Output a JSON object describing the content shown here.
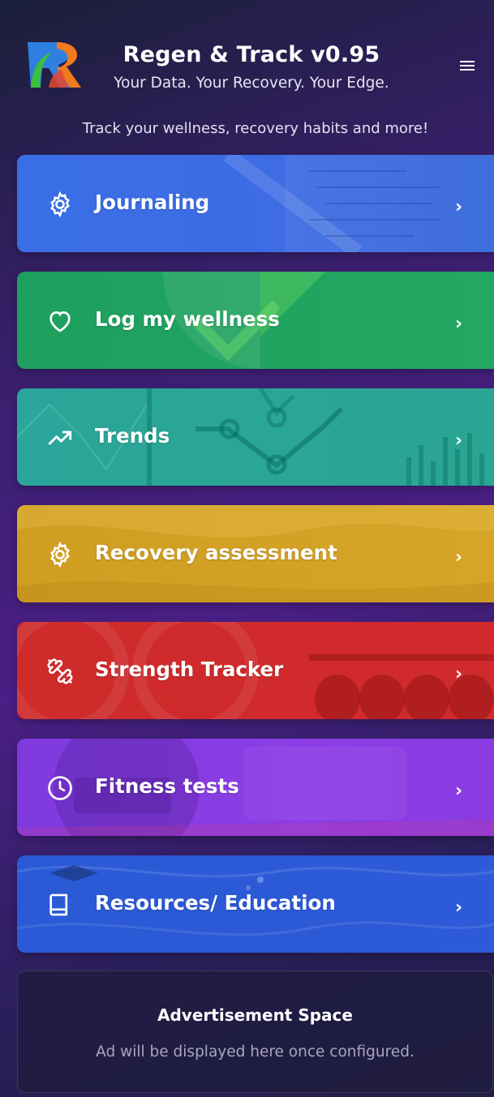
{
  "header": {
    "title": "Regen & Track v0.95",
    "tagline": "Your Data. Your Recovery. Your Edge.",
    "menu_icon": "hamburger-menu-icon"
  },
  "subtitle": "Track your wellness, recovery habits and more!",
  "cards": [
    {
      "label": "Journaling",
      "icon": "gear-icon",
      "color": "#3b6fe0"
    },
    {
      "label": "Log my wellness",
      "icon": "heart-icon",
      "color": "#1fa35f"
    },
    {
      "label": "Trends",
      "icon": "trending-up-icon",
      "color": "#2aa596"
    },
    {
      "label": "Recovery assessment",
      "icon": "gear-icon",
      "color": "#d4a121"
    },
    {
      "label": "Strength Tracker",
      "icon": "dumbbell-icon",
      "color": "#cf2a2a"
    },
    {
      "label": "Fitness tests",
      "icon": "clock-icon",
      "color": "#8b3ce0"
    },
    {
      "label": "Resources/ Education",
      "icon": "book-icon",
      "color": "#2b58d4"
    }
  ],
  "chevron": "›",
  "ad": {
    "title": "Advertisement Space",
    "text": "Ad will be displayed here once configured."
  }
}
